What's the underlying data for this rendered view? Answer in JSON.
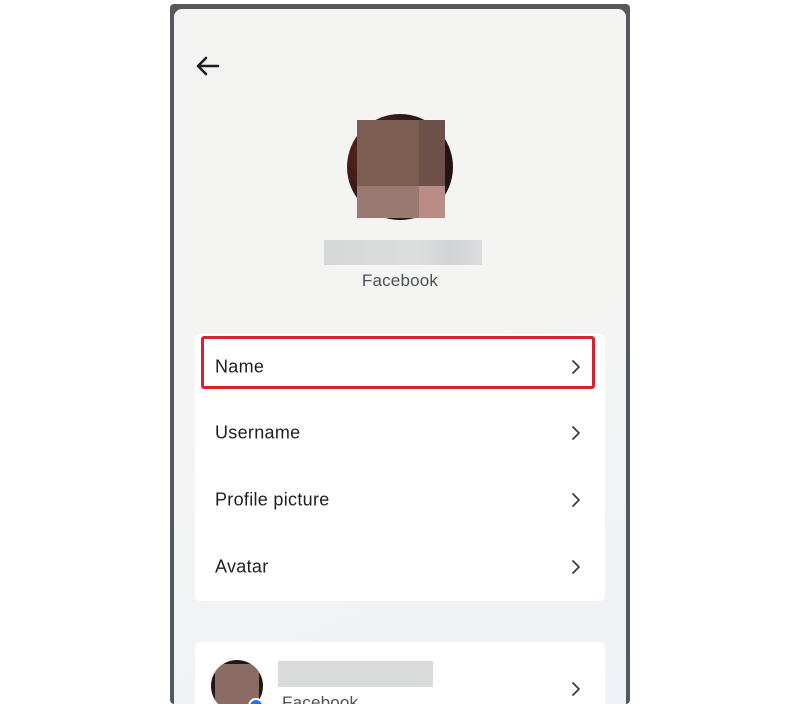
{
  "header": {
    "back_icon": "arrow-left-icon"
  },
  "profile": {
    "avatar_icon": "profile-photo",
    "name": "",
    "subtitle": "Facebook"
  },
  "settings": {
    "items": [
      {
        "label": "Name",
        "icon": "chevron-right-icon",
        "highlighted": true
      },
      {
        "label": "Username",
        "icon": "chevron-right-icon"
      },
      {
        "label": "Profile picture",
        "icon": "chevron-right-icon"
      },
      {
        "label": "Avatar",
        "icon": "chevron-right-icon"
      }
    ]
  },
  "account": {
    "name": "",
    "subtitle": "Facebook",
    "icon": "chevron-right-icon"
  },
  "colors": {
    "highlight": "#d8222f",
    "text": "#1c1e21",
    "muted": "#4b4f56",
    "frame": "#55585c",
    "facebook_blue": "#1877f2"
  }
}
